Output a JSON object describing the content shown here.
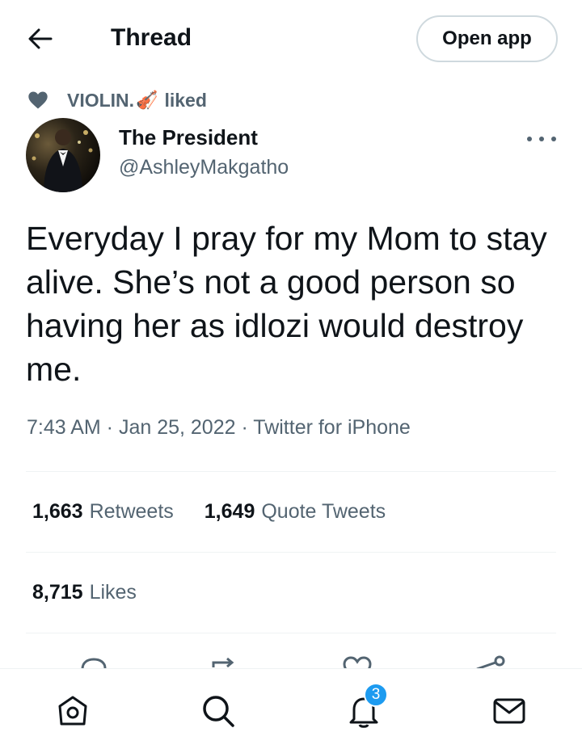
{
  "header": {
    "title": "Thread",
    "open_app_label": "Open app",
    "back_icon": "arrow-left-icon"
  },
  "social_context": {
    "user": "VIOLIN.",
    "emoji": "🎻",
    "action": "liked",
    "icon": "heart-icon"
  },
  "tweet": {
    "author_name": "The President",
    "author_handle": "@AshleyMakgatho",
    "text": "Everyday I pray for my Mom to stay alive. She’s not a good person so having her as idlozi would destroy me.",
    "time": "7:43 AM",
    "date": "Jan 25, 2022",
    "source": "Twitter for iPhone",
    "meta_line": "7:43 AM · Jan 25, 2022 · Twitter for iPhone"
  },
  "stats": {
    "retweets_count": "1,663",
    "retweets_label": "Retweets",
    "quote_tweets_count": "1,649",
    "quote_tweets_label": "Quote Tweets",
    "likes_count": "8,715",
    "likes_label": "Likes"
  },
  "actions": [
    "reply-icon",
    "retweet-icon",
    "like-icon",
    "share-icon"
  ],
  "bottom_nav": {
    "items": [
      "home-icon",
      "search-icon",
      "notifications-icon",
      "messages-icon"
    ],
    "notifications_badge": "3"
  },
  "colors": {
    "text_primary": "#0f1419",
    "text_secondary": "#536471",
    "accent": "#1d9bf0",
    "border": "#cfd9de"
  }
}
